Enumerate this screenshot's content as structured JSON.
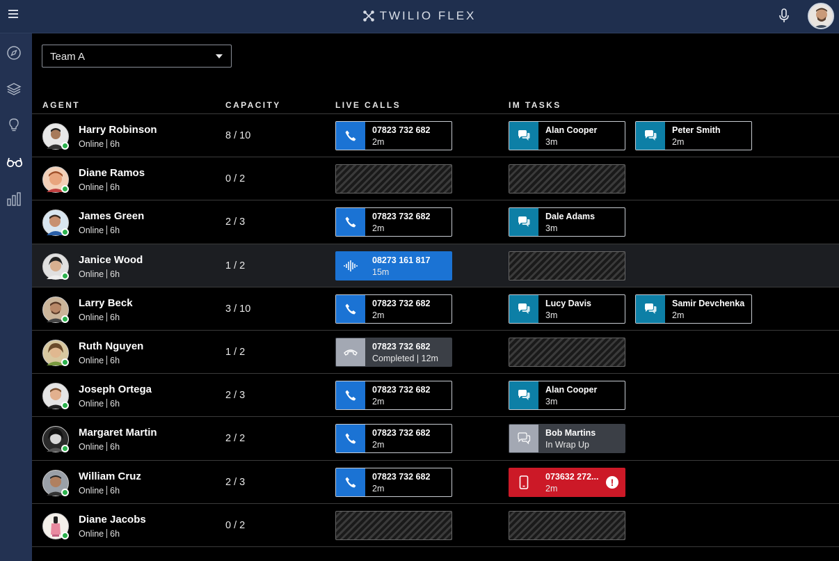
{
  "header": {
    "title": "TWILIO FLEX"
  },
  "icons": {
    "menu": "hamburger-icon",
    "logo": "twilio-logo-icon",
    "mic": "microphone-icon",
    "sidebar": [
      "compass-icon",
      "layers-icon",
      "lightbulb-icon",
      "glasses-icon",
      "bar-chart-icon"
    ]
  },
  "colors": {
    "call": "#1b73d4",
    "chat": "#0d7fa6",
    "alert": "#cc1927",
    "online": "#2bb14c",
    "header": "#1f2f4e"
  },
  "team_select": {
    "value": "Team A"
  },
  "columns": {
    "agent": "AGENT",
    "capacity": "CAPACITY",
    "live_calls": "LIVE CALLS",
    "im_tasks": "IM TASKS"
  },
  "agents": [
    {
      "name": "Harry Robinson",
      "status": "Online",
      "duration": "6h",
      "capacity": "8 / 10",
      "call": {
        "number": "07823 732 682",
        "time": "2m"
      },
      "im": [
        {
          "name": "Alan Cooper",
          "time": "3m"
        },
        {
          "name": "Peter Smith",
          "time": "2m"
        }
      ]
    },
    {
      "name": "Diane Ramos",
      "status": "Online",
      "duration": "6h",
      "capacity": "0 / 2"
    },
    {
      "name": "James Green",
      "status": "Online",
      "duration": "6h",
      "capacity": "2 / 3",
      "call": {
        "number": "07823 732 682",
        "time": "2m"
      },
      "im": [
        {
          "name": "Dale Adams",
          "time": "3m"
        }
      ]
    },
    {
      "name": "Janice Wood",
      "status": "Online",
      "duration": "6h",
      "capacity": "1 / 2",
      "call": {
        "number": "08273 161 817",
        "time": "15m"
      }
    },
    {
      "name": "Larry Beck",
      "status": "Online",
      "duration": "6h",
      "capacity": "3 / 10",
      "call": {
        "number": "07823 732 682",
        "time": "2m"
      },
      "im": [
        {
          "name": "Lucy Davis",
          "time": "3m"
        },
        {
          "name": "Samir Devchenka",
          "time": "2m"
        }
      ]
    },
    {
      "name": "Ruth Nguyen",
      "status": "Online",
      "duration": "6h",
      "capacity": "1 / 2",
      "call": {
        "number": "07823 732 682",
        "state": "Completed",
        "time": "12m"
      }
    },
    {
      "name": "Joseph Ortega",
      "status": "Online",
      "duration": "6h",
      "capacity": "2 / 3",
      "call": {
        "number": "07823 732 682",
        "time": "2m"
      },
      "im": [
        {
          "name": "Alan Cooper",
          "time": "3m"
        }
      ]
    },
    {
      "name": "Margaret Martin",
      "status": "Online",
      "duration": "6h",
      "capacity": "2 / 2",
      "call": {
        "number": "07823 732 682",
        "time": "2m"
      },
      "im": [
        {
          "name": "Bob Martins",
          "time": "In Wrap Up"
        }
      ]
    },
    {
      "name": "William Cruz",
      "status": "Online",
      "duration": "6h",
      "capacity": "2 / 3",
      "call": {
        "number": "07823 732 682",
        "time": "2m"
      },
      "im": [
        {
          "name": "073632 272...",
          "time": "2m"
        }
      ]
    },
    {
      "name": "Diane Jacobs",
      "status": "Online",
      "duration": "6h",
      "capacity": "0 / 2"
    }
  ]
}
